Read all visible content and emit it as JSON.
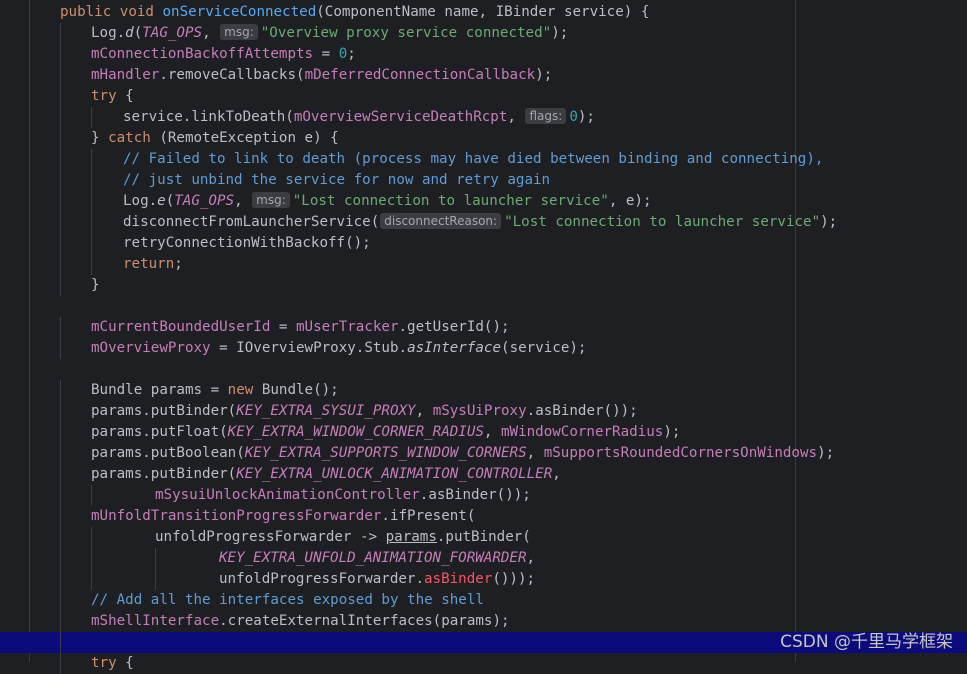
{
  "editor": {
    "lines": [
      {
        "tokens": [
          [
            "kw",
            "public void "
          ],
          [
            "fn",
            "onServiceConnected"
          ],
          [
            "plain",
            "(ComponentName name, IBinder service) {"
          ]
        ]
      },
      {
        "tokens": [
          [
            "plain",
            "Log."
          ],
          [
            "italic",
            "d"
          ],
          [
            "plain",
            "("
          ],
          [
            "cst",
            "TAG_OPS"
          ],
          [
            "plain",
            ", "
          ],
          [
            "hint",
            "msg:"
          ],
          [
            "str",
            "\"Overview proxy service connected\""
          ],
          [
            "plain",
            ");"
          ]
        ]
      },
      {
        "tokens": [
          [
            "fld",
            "mConnectionBackoffAttempts"
          ],
          [
            "plain",
            " = "
          ],
          [
            "num",
            "0"
          ],
          [
            "plain",
            ";"
          ]
        ]
      },
      {
        "tokens": [
          [
            "fld",
            "mHandler"
          ],
          [
            "plain",
            ".removeCallbacks("
          ],
          [
            "fld",
            "mDeferredConnectionCallback"
          ],
          [
            "plain",
            ");"
          ]
        ]
      },
      {
        "tokens": [
          [
            "kw",
            "try"
          ],
          [
            "plain",
            " {"
          ]
        ]
      },
      {
        "tokens": [
          [
            "plain",
            "service.linkToDeath("
          ],
          [
            "fld",
            "mOverviewServiceDeathRcpt"
          ],
          [
            "plain",
            ", "
          ],
          [
            "hint",
            "flags:"
          ],
          [
            "num",
            "0"
          ],
          [
            "plain",
            ");"
          ]
        ]
      },
      {
        "tokens": [
          [
            "plain",
            "} "
          ],
          [
            "kw",
            "catch"
          ],
          [
            "plain",
            " (RemoteException e) {"
          ]
        ]
      },
      {
        "tokens": [
          [
            "cmtb",
            "// Failed to link to death (process may have died between binding and connecting),"
          ]
        ]
      },
      {
        "tokens": [
          [
            "cmtb",
            "// just unbind the service for now and retry again"
          ]
        ]
      },
      {
        "tokens": [
          [
            "plain",
            "Log."
          ],
          [
            "italic",
            "e"
          ],
          [
            "plain",
            "("
          ],
          [
            "cst",
            "TAG_OPS"
          ],
          [
            "plain",
            ", "
          ],
          [
            "hint",
            "msg:"
          ],
          [
            "str",
            "\"Lost connection to launcher service\""
          ],
          [
            "plain",
            ", e);"
          ]
        ]
      },
      {
        "tokens": [
          [
            "plain",
            "disconnectFromLauncherService("
          ],
          [
            "hint",
            "disconnectReason:"
          ],
          [
            "str",
            "\"Lost connection to launcher service\""
          ],
          [
            "plain",
            ");"
          ]
        ]
      },
      {
        "tokens": [
          [
            "plain",
            "retryConnectionWithBackoff();"
          ]
        ]
      },
      {
        "tokens": [
          [
            "kw",
            "return"
          ],
          [
            "plain",
            ";"
          ]
        ]
      },
      {
        "tokens": [
          [
            "plain",
            "}"
          ]
        ]
      },
      {
        "tokens": []
      },
      {
        "tokens": [
          [
            "fld",
            "mCurrentBoundedUserId"
          ],
          [
            "plain",
            " = "
          ],
          [
            "fld",
            "mUserTracker"
          ],
          [
            "plain",
            ".getUserId();"
          ]
        ]
      },
      {
        "tokens": [
          [
            "fld",
            "mOverviewProxy"
          ],
          [
            "plain",
            " = IOverviewProxy.Stub."
          ],
          [
            "italic",
            "asInterface"
          ],
          [
            "plain",
            "(service);"
          ]
        ]
      },
      {
        "tokens": []
      },
      {
        "tokens": [
          [
            "plain",
            "Bundle params = "
          ],
          [
            "kw",
            "new"
          ],
          [
            "plain",
            " Bundle();"
          ]
        ]
      },
      {
        "tokens": [
          [
            "plain",
            "params.putBinder("
          ],
          [
            "cst",
            "KEY_EXTRA_SYSUI_PROXY"
          ],
          [
            "plain",
            ", "
          ],
          [
            "fld",
            "mSysUiProxy"
          ],
          [
            "plain",
            ".asBinder());"
          ]
        ]
      },
      {
        "tokens": [
          [
            "plain",
            "params.putFloat("
          ],
          [
            "cst",
            "KEY_EXTRA_WINDOW_CORNER_RADIUS"
          ],
          [
            "plain",
            ", "
          ],
          [
            "fld",
            "mWindowCornerRadius"
          ],
          [
            "plain",
            ");"
          ]
        ]
      },
      {
        "tokens": [
          [
            "plain",
            "params.putBoolean("
          ],
          [
            "cst",
            "KEY_EXTRA_SUPPORTS_WINDOW_CORNERS"
          ],
          [
            "plain",
            ", "
          ],
          [
            "fld",
            "mSupportsRoundedCornersOnWindows"
          ],
          [
            "plain",
            ");"
          ]
        ]
      },
      {
        "tokens": [
          [
            "plain",
            "params.putBinder("
          ],
          [
            "cst",
            "KEY_EXTRA_UNLOCK_ANIMATION_CONTROLLER"
          ],
          [
            "plain",
            ","
          ]
        ]
      },
      {
        "tokens": [
          [
            "fld",
            "mSysuiUnlockAnimationController"
          ],
          [
            "plain",
            ".asBinder());"
          ]
        ]
      },
      {
        "tokens": [
          [
            "fld",
            "mUnfoldTransitionProgressForwarder"
          ],
          [
            "plain",
            ".ifPresent("
          ]
        ]
      },
      {
        "tokens": [
          [
            "plain",
            "unfoldProgressForwarder -> "
          ],
          [
            "ul",
            "params"
          ],
          [
            "plain",
            ".putBinder("
          ]
        ]
      },
      {
        "tokens": [
          [
            "cst",
            "KEY_EXTRA_UNFOLD_ANIMATION_FORWARDER"
          ],
          [
            "plain",
            ","
          ]
        ]
      },
      {
        "tokens": [
          [
            "plain",
            "unfoldProgressForwarder."
          ],
          [
            "red",
            "asBinder"
          ],
          [
            "plain",
            "()));"
          ]
        ]
      },
      {
        "tokens": [
          [
            "cmtb",
            "// Add all the interfaces exposed by the shell"
          ]
        ]
      },
      {
        "tokens": [
          [
            "fld",
            "mShellInterface"
          ],
          [
            "plain",
            ".createExternalInterfaces(params);"
          ]
        ]
      },
      {
        "tokens": []
      },
      {
        "tokens": [
          [
            "kw",
            "try"
          ],
          [
            "plain",
            " {"
          ]
        ]
      }
    ]
  },
  "watermark": "CSDN @千里马学框架"
}
